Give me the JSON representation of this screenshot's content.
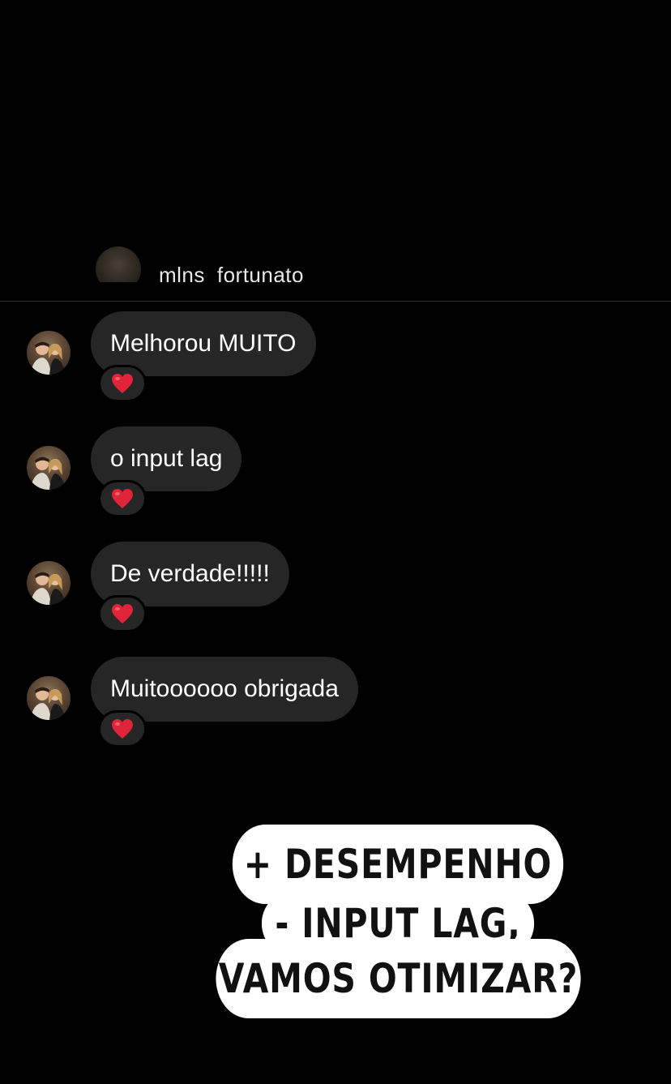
{
  "header": {
    "username": "mlns_fortunato"
  },
  "messages": [
    {
      "text": "Melhorou MUITO",
      "reaction": "heart-icon"
    },
    {
      "text": "o input lag",
      "reaction": "heart-icon"
    },
    {
      "text": "De verdade!!!!!",
      "reaction": "heart-icon"
    },
    {
      "text": "Muitoooooo obrigada",
      "reaction": "heart-icon"
    }
  ],
  "sticker": {
    "line1": "+ DESEMPENHO",
    "line2": "- INPUT LAG,",
    "line3": "VAMOS OTIMIZAR?"
  },
  "colors": {
    "background": "#000000",
    "bubble": "#262626",
    "sticker": "#ffffff",
    "heart": "#e0243a"
  }
}
